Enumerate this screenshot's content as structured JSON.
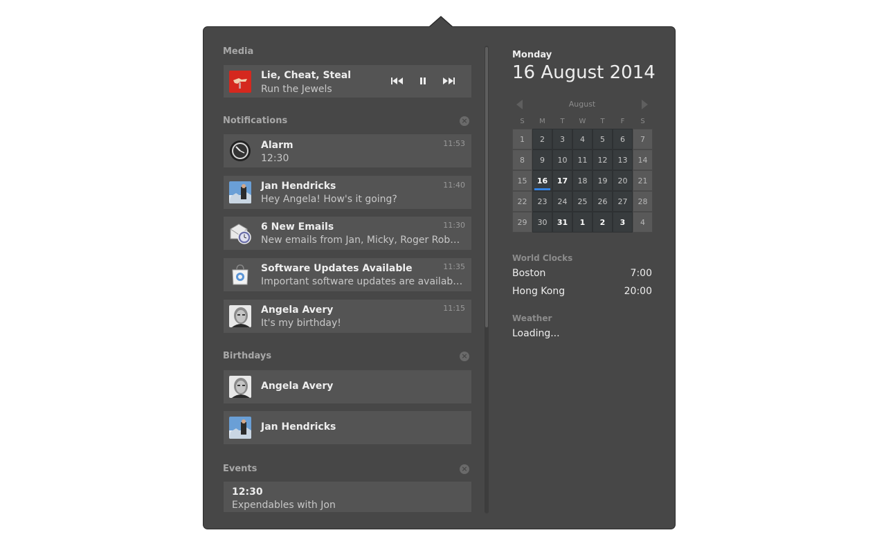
{
  "media": {
    "section_title": "Media",
    "track_title": "Lie, Cheat, Steal",
    "artist": "Run the Jewels",
    "album_art": "album-art",
    "controls": {
      "prev": "⏮",
      "pause": "⏸",
      "next": "⏭"
    }
  },
  "notifications": {
    "section_title": "Notifications",
    "items": [
      {
        "icon": "clock-icon",
        "title": "Alarm",
        "body": "12:30",
        "time": "11:53"
      },
      {
        "icon": "avatar-jan",
        "title": "Jan Hendricks",
        "body": "Hey Angela! How's it going?",
        "time": "11:40"
      },
      {
        "icon": "mail-icon",
        "title": "6 New Emails",
        "body": "New emails from Jan, Micky, Roger Robert...",
        "time": "11:30"
      },
      {
        "icon": "software-update-icon",
        "title": "Software Updates Available",
        "body": "Important software updates are available t...",
        "time": "11:35"
      },
      {
        "icon": "avatar-angela",
        "title": "Angela Avery",
        "body": "It's my birthday!",
        "time": "11:15"
      }
    ]
  },
  "birthdays": {
    "section_title": "Birthdays",
    "items": [
      {
        "icon": "avatar-angela",
        "name": "Angela Avery"
      },
      {
        "icon": "avatar-jan",
        "name": "Jan Hendricks"
      }
    ]
  },
  "events": {
    "section_title": "Events",
    "items": [
      {
        "time": "12:30",
        "title": "Expendables with Jon"
      }
    ]
  },
  "date": {
    "weekday": "Monday",
    "full": "16 August 2014"
  },
  "calendar": {
    "month": "August",
    "weekdays": [
      "S",
      "M",
      "T",
      "W",
      "T",
      "F",
      "S"
    ],
    "days": [
      "1",
      "2",
      "3",
      "4",
      "5",
      "6",
      "7",
      "8",
      "9",
      "10",
      "11",
      "12",
      "13",
      "14",
      "15",
      "16",
      "17",
      "18",
      "19",
      "20",
      "21",
      "22",
      "23",
      "24",
      "25",
      "26",
      "27",
      "28",
      "29",
      "30",
      "31",
      "1",
      "2",
      "3",
      "4"
    ],
    "today": "16",
    "accent_color": "#3584e4"
  },
  "world_clocks": {
    "title": "World Clocks",
    "items": [
      {
        "city": "Boston",
        "time": "7:00"
      },
      {
        "city": "Hong Kong",
        "time": "20:00"
      }
    ]
  },
  "weather": {
    "title": "Weather",
    "status": "Loading..."
  }
}
